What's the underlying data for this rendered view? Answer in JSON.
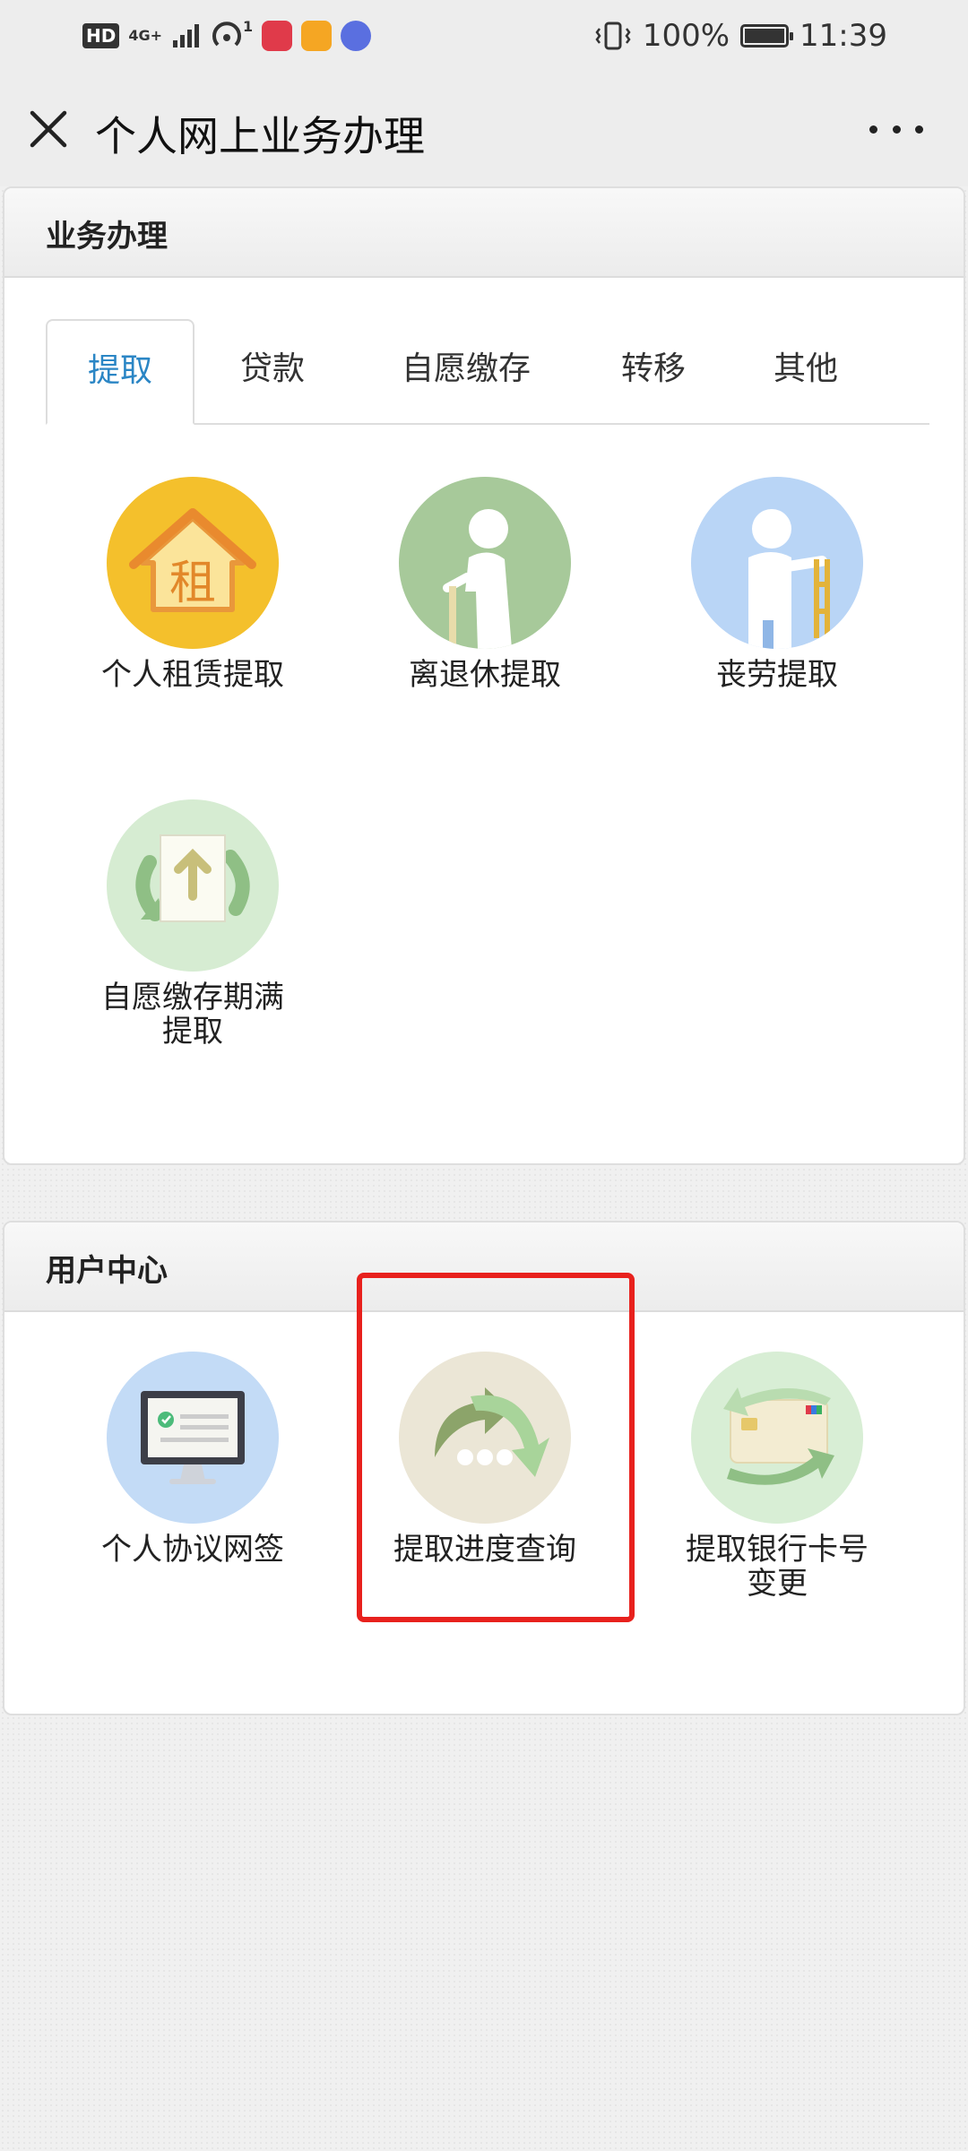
{
  "status_bar": {
    "hd_label": "HD",
    "network_label": "4G+",
    "notification_count": "1",
    "battery": "100%",
    "battery_level": 1.0,
    "time": "11:39"
  },
  "nav": {
    "title": "个人网上业务办理",
    "close_icon": "close-icon",
    "more_icon": "more-icon"
  },
  "business": {
    "title": "业务办理",
    "tabs": [
      {
        "label": "提取",
        "active": true
      },
      {
        "label": "贷款",
        "active": false
      },
      {
        "label": "自愿缴存",
        "active": false
      },
      {
        "label": "转移",
        "active": false
      },
      {
        "label": "其他",
        "active": false
      }
    ],
    "items": [
      {
        "label": "个人租赁提取",
        "icon": "rent-house-icon",
        "icon_glyph": "租",
        "color": "#f4c02c"
      },
      {
        "label": "离退休提取",
        "icon": "retiree-icon",
        "color": "#a7c99a"
      },
      {
        "label": "丧劳提取",
        "icon": "disability-icon",
        "color": "#b9d5f6"
      },
      {
        "label": "自愿缴存期满提取",
        "label_line1": "自愿缴存期满",
        "label_line2": "提取",
        "icon": "voluntary-deposit-icon",
        "color": "#d6ecd2"
      }
    ]
  },
  "user_center": {
    "title": "用户中心",
    "items": [
      {
        "label": "个人协议网签",
        "icon": "agreement-monitor-icon",
        "color": "#c3dbf6"
      },
      {
        "label": "提取进度查询",
        "icon": "progress-query-icon",
        "color": "#ebe6d6",
        "highlighted": true
      },
      {
        "label": "提取银行卡号变更",
        "label_line1": "提取银行卡号",
        "label_line2": "变更",
        "icon": "bank-card-icon",
        "color": "#d8eed5"
      }
    ]
  },
  "colors": {
    "accent_tab": "#2b86c5",
    "highlight": "#e8211d",
    "background": "#f0f0f0"
  }
}
